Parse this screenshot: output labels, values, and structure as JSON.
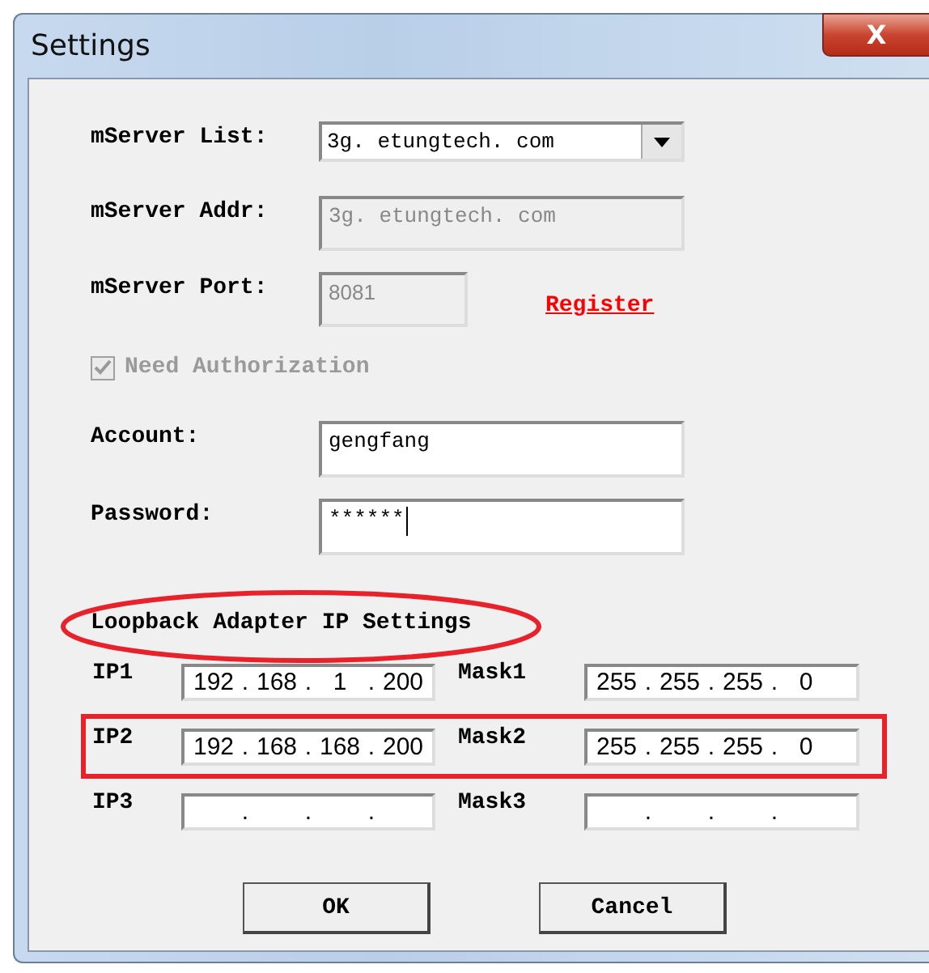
{
  "window": {
    "title": "Settings",
    "close_label": "X"
  },
  "server": {
    "list_label": "mServer List:",
    "list_value": "3g. etungtech. com",
    "addr_label": "mServer Addr:",
    "addr_value": "3g. etungtech. com",
    "addr_disabled": true,
    "port_label": "mServer Port:",
    "port_value": "8081",
    "port_disabled": true,
    "register_link": "Register"
  },
  "authorization": {
    "label": "Need Authorization",
    "checked": true,
    "disabled": true
  },
  "account": {
    "label": "Account:",
    "value": "gengfang"
  },
  "password": {
    "label": "Password:",
    "value": "******"
  },
  "loopback": {
    "heading": "Loopback Adapter IP Settings",
    "circled": true,
    "separator": ".",
    "rows": [
      {
        "ip_label": "IP1",
        "ip": [
          "192",
          "168",
          "1",
          "200"
        ],
        "mask_label": "Mask1",
        "mask": [
          "255",
          "255",
          "255",
          "0"
        ],
        "highlighted": false
      },
      {
        "ip_label": "IP2",
        "ip": [
          "192",
          "168",
          "168",
          "200"
        ],
        "mask_label": "Mask2",
        "mask": [
          "255",
          "255",
          "255",
          "0"
        ],
        "highlighted": true
      },
      {
        "ip_label": "IP3",
        "mask_label": "Mask3",
        "highlighted": false
      }
    ]
  },
  "buttons": [
    "OK",
    "Cancel"
  ]
}
